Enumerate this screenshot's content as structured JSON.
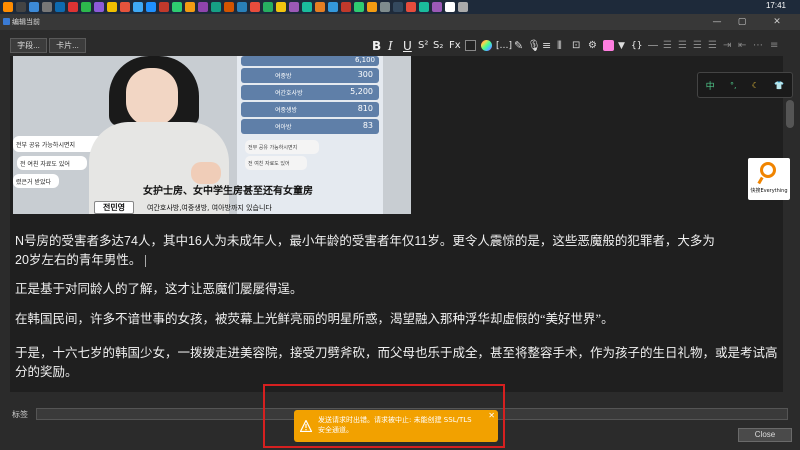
{
  "taskbar": {
    "time": "17:41"
  },
  "window": {
    "title": "编辑当前",
    "min": "—",
    "max": "▢",
    "close": "✕"
  },
  "toolbar": {
    "fields_button": "字段...",
    "cards_button": "卡片...",
    "bold": "B",
    "italic": "I",
    "underline": "U",
    "superscript": "S²",
    "subscript": "S₂",
    "clear_format": "Fx",
    "insert": "[…]",
    "brackets": "{}"
  },
  "video": {
    "overlay_left": [
      "전부 공유 가능하시면지",
      "전 여친 자료도 있어",
      "렸은거 받았다"
    ],
    "rows": [
      {
        "label": "6,100"
      },
      {
        "label": "300"
      },
      {
        "label": "5,200"
      },
      {
        "label": "810"
      },
      {
        "label": "83"
      }
    ],
    "row_titles": [
      "",
      "여중방",
      "여간호사방",
      "여중생방",
      "여아방"
    ],
    "caption_cn": "女护士房、女中学生房甚至还有女童房",
    "speaker": "전민영",
    "caption_kr": "여간호사방,여중생방, 여아방까지 있습니다",
    "right_card_a": "전부 공유 가능하시면지",
    "right_card_b": "전 여친 자료도 있어"
  },
  "content": {
    "p1_a": "N",
    "p1_b": "号房的受害者多达",
    "p1_c": "74",
    "p1_d": "人，其中",
    "p1_e": "16",
    "p1_f": "人为未成年人，最小年龄的受害者年仅",
    "p1_g": "11",
    "p1_h": "岁。更令人震惊的是，这些恶魔般的犯罪者，大多为",
    "p1_i": "20",
    "p1_j": "岁左右的青年男性。",
    "p2": "正是基于对同龄人的了解，这才让恶魔们屡屡得逞。",
    "p3": "在韩国民间，许多不谙世事的女孩，被荧幕上光鲜亮丽的明星所惑，渴望融入那种浮华却虚假的“美好世界”。",
    "p4": "于是，十六七岁的韩国少女，一拨拨走进美容院，接受刀劈斧砍，而父母也乐于成全，甚至将整容手术，作为孩子的生日礼物，或是考试高分的奖励。"
  },
  "ime": {
    "lang": "中",
    "punct": "°,",
    "moon": "☾",
    "skin": "👕"
  },
  "everything": {
    "label": "快搜Everything"
  },
  "footer": {
    "tags_label": "标签",
    "close_label": "Close"
  },
  "toast": {
    "line1": "发送请求时出错。请求被中止: 未能创建 SSL/TLS",
    "line2": "安全通道。",
    "close": "✕"
  }
}
